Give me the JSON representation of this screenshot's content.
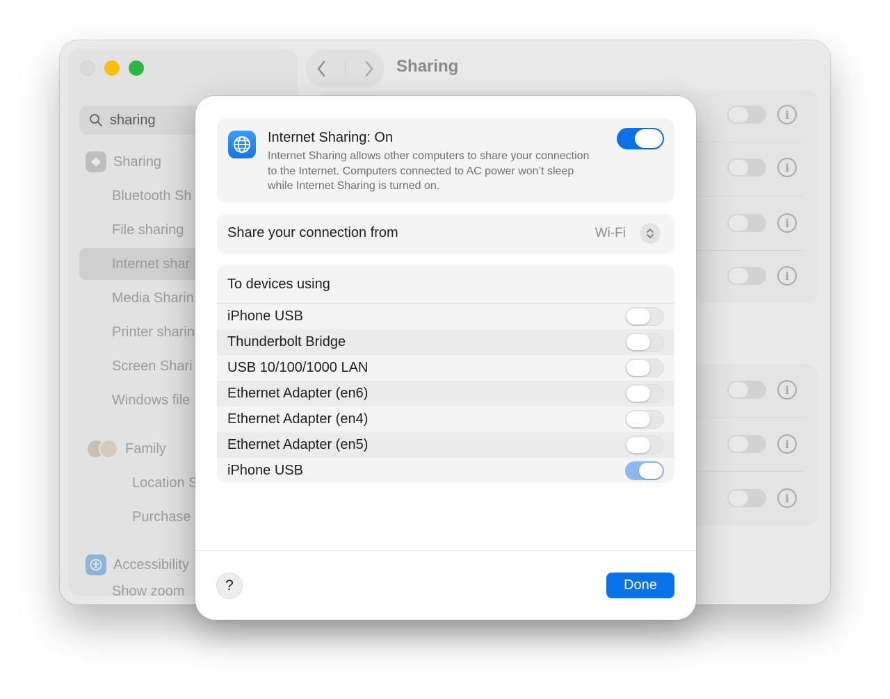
{
  "window": {
    "title": "Sharing",
    "search_value": "sharing"
  },
  "sidebar": {
    "items": [
      {
        "label": "Sharing"
      },
      {
        "label": "Bluetooth Sh"
      },
      {
        "label": "File sharing"
      },
      {
        "label": "Internet shar"
      },
      {
        "label": "Media Sharin"
      },
      {
        "label": "Printer sharin"
      },
      {
        "label": "Screen Shari"
      },
      {
        "label": "Windows file"
      },
      {
        "label": "Family"
      },
      {
        "label": "Location S"
      },
      {
        "label": "Purchase"
      },
      {
        "label": "Accessibility"
      },
      {
        "label": "Show zoom"
      }
    ]
  },
  "sheet": {
    "service_title": "Internet Sharing: On",
    "service_description": "Internet Sharing allows other computers to share your connection to the Internet. Computers connected to AC power won’t sleep while Internet Sharing is turned on.",
    "service_enabled": true,
    "share_from_label": "Share your connection from",
    "share_from_value": "Wi-Fi",
    "devices_header": "To devices using",
    "devices": [
      {
        "name": "iPhone USB",
        "enabled": false
      },
      {
        "name": "Thunderbolt Bridge",
        "enabled": false
      },
      {
        "name": "USB 10/100/1000 LAN",
        "enabled": false
      },
      {
        "name": "Ethernet Adapter (en6)",
        "enabled": false
      },
      {
        "name": "Ethernet Adapter (en4)",
        "enabled": false
      },
      {
        "name": "Ethernet Adapter (en5)",
        "enabled": false
      },
      {
        "name": "iPhone USB",
        "enabled": true
      }
    ],
    "help_label": "?",
    "done_label": "Done"
  },
  "colors": {
    "accent": "#0a72e8",
    "toggle_on_dim": "#8db8ee"
  }
}
